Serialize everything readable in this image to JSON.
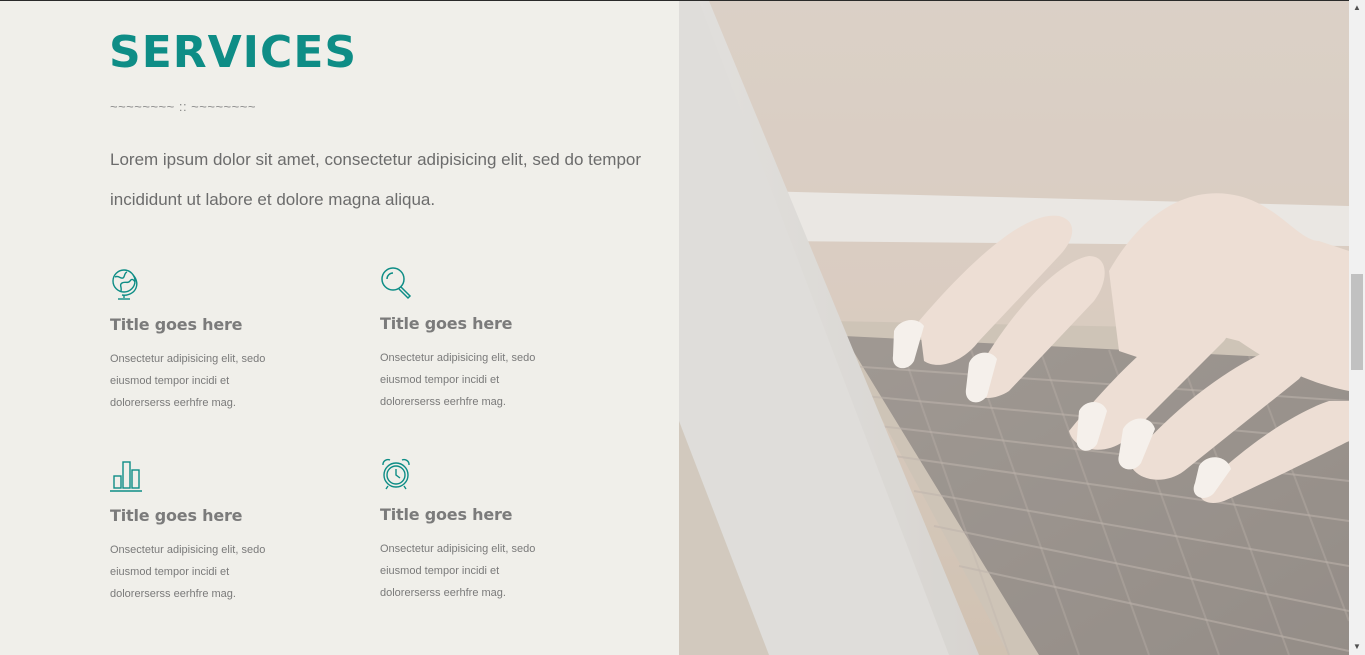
{
  "section": {
    "title": "SERVICES",
    "divider": "~~~~~~~~ :: ~~~~~~~~",
    "intro": "Lorem ipsum dolor sit amet, consectetur adipisicing elit, sed do tempor incididunt ut labore et dolore magna aliqua."
  },
  "services": [
    {
      "icon": "globe-icon",
      "title": "Title goes here",
      "text": "Onsectetur adipisicing elit, sedo eiusmod tempor incidi et dolorerserss eerhfre mag."
    },
    {
      "icon": "search-icon",
      "title": "Title goes here",
      "text": "Onsectetur adipisicing elit, sedo eiusmod tempor incidi et dolorerserss eerhfre mag."
    },
    {
      "icon": "bar-chart-icon",
      "title": "Title goes here",
      "text": "Onsectetur adipisicing elit, sedo eiusmod tempor incidi et dolorerserss eerhfre mag."
    },
    {
      "icon": "alarm-clock-icon",
      "title": "Title goes here",
      "text": "Onsectetur adipisicing elit, sedo eiusmod tempor incidi et dolorerserss eerhfre mag."
    }
  ],
  "colors": {
    "accent": "#0e8d86",
    "background": "#f0efea",
    "text": "#6c6c6c"
  }
}
